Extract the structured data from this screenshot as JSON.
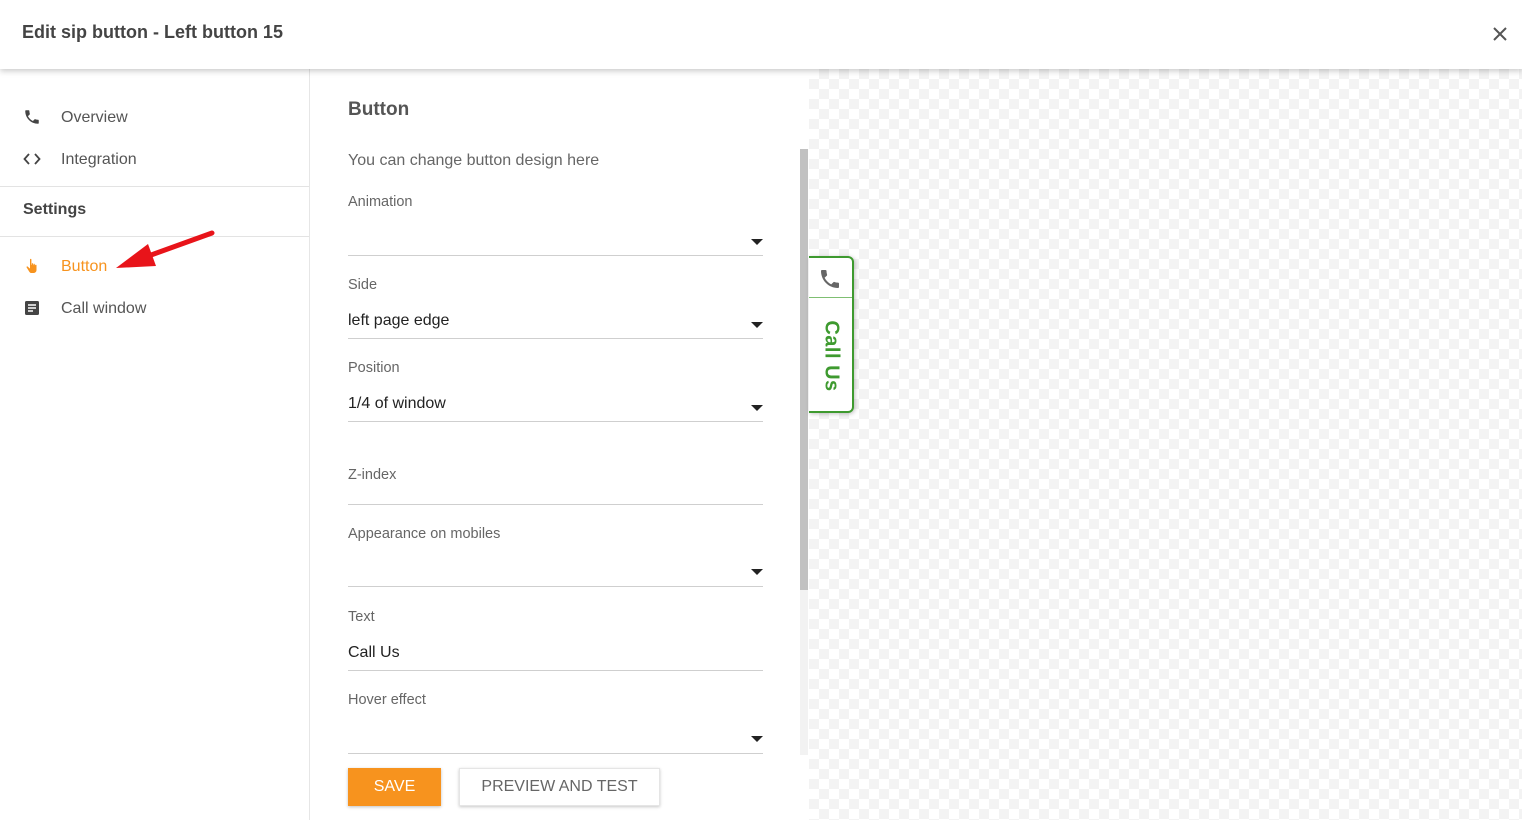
{
  "header": {
    "title": "Edit sip button - Left button 15",
    "close_icon": "close-icon"
  },
  "sidebar": {
    "nav": [
      {
        "label": "Overview",
        "icon": "phone-icon"
      },
      {
        "label": "Integration",
        "icon": "code-icon"
      }
    ],
    "settings_title": "Settings",
    "settings_items": [
      {
        "label": "Button",
        "icon": "hand-pointer-icon",
        "active": true
      },
      {
        "label": "Call window",
        "icon": "document-icon"
      }
    ],
    "active_color": "#f7931e"
  },
  "form": {
    "title": "Button",
    "description": "You can change button design here",
    "fields": {
      "animation": {
        "label": "Animation",
        "value": ""
      },
      "side": {
        "label": "Side",
        "value": "left page edge"
      },
      "position": {
        "label": "Position",
        "value": "1/4 of window"
      },
      "zindex": {
        "label": "Z-index",
        "value": ""
      },
      "mobiles": {
        "label": "Appearance on mobiles",
        "value": ""
      },
      "text": {
        "label": "Text",
        "value": "Call Us"
      },
      "hover": {
        "label": "Hover effect",
        "value": ""
      }
    },
    "save_label": "SAVE",
    "preview_label": "PREVIEW AND TEST"
  },
  "preview": {
    "button_text": "Call Us",
    "button_icon": "phone-icon",
    "button_color": "#3e9a2f"
  }
}
